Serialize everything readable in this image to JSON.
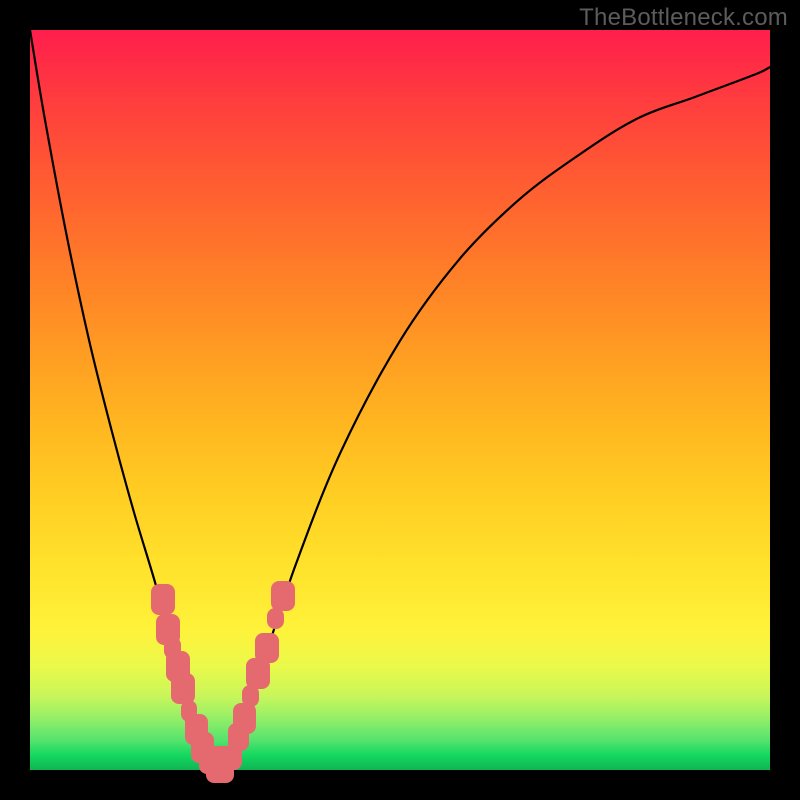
{
  "watermark": "TheBottleneck.com",
  "chart_data": {
    "type": "line",
    "title": "",
    "xlabel": "",
    "ylabel": "",
    "xlim": [
      0,
      100
    ],
    "ylim": [
      0,
      100
    ],
    "legend": false,
    "grid": false,
    "annotations": [],
    "series": [
      {
        "name": "bottleneck-curve",
        "x": [
          0,
          2,
          5,
          8,
          11,
          14,
          17,
          20,
          22,
          24,
          25.5,
          27,
          29,
          32,
          36,
          42,
          50,
          58,
          66,
          74,
          82,
          90,
          98,
          100
        ],
        "y": [
          100,
          88,
          72,
          58,
          46,
          35,
          25,
          14,
          7,
          3,
          0.5,
          2,
          7,
          16,
          28,
          43,
          58,
          69,
          77,
          83,
          88,
          91,
          94,
          95
        ]
      }
    ],
    "points_near_minimum": [
      {
        "x": 18.0,
        "y": 23,
        "size": 2.0
      },
      {
        "x": 18.7,
        "y": 19,
        "size": 2.0
      },
      {
        "x": 19.3,
        "y": 16.5,
        "size": 1.4
      },
      {
        "x": 20.0,
        "y": 14,
        "size": 2.0
      },
      {
        "x": 20.7,
        "y": 11,
        "size": 2.0
      },
      {
        "x": 21.5,
        "y": 8,
        "size": 1.4
      },
      {
        "x": 22.5,
        "y": 5.5,
        "size": 2.0
      },
      {
        "x": 23.3,
        "y": 3,
        "size": 2.0
      },
      {
        "x": 24.3,
        "y": 1.3,
        "size": 1.8
      },
      {
        "x": 25.7,
        "y": 0.7,
        "size": 2.4
      },
      {
        "x": 27.4,
        "y": 1.7,
        "size": 1.6
      },
      {
        "x": 28.2,
        "y": 4.5,
        "size": 1.8
      },
      {
        "x": 29.0,
        "y": 7,
        "size": 2.0
      },
      {
        "x": 29.8,
        "y": 10,
        "size": 1.4
      },
      {
        "x": 30.8,
        "y": 13,
        "size": 2.0
      },
      {
        "x": 32.0,
        "y": 16.5,
        "size": 2.0
      },
      {
        "x": 33.2,
        "y": 20.5,
        "size": 1.4
      },
      {
        "x": 34.2,
        "y": 23.5,
        "size": 2.0
      }
    ]
  },
  "colors": {
    "curve_stroke": "#000000",
    "marker_fill": "#e56a6f"
  }
}
